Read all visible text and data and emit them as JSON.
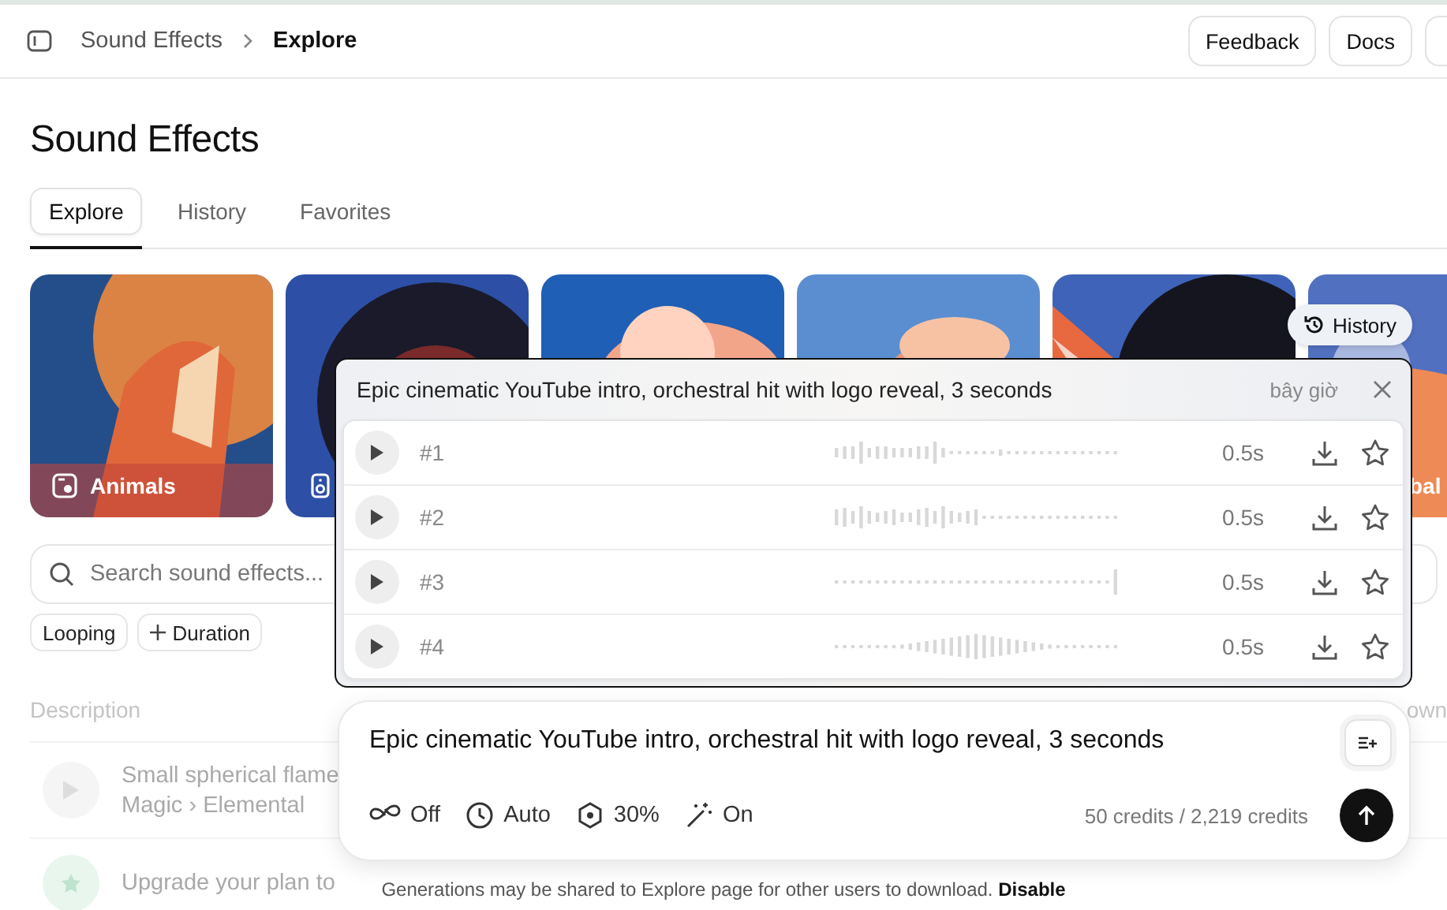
{
  "breadcrumb": {
    "parent": "Sound Effects",
    "current": "Explore"
  },
  "header_buttons": [
    "Feedback",
    "Docs"
  ],
  "title": "Sound Effects",
  "tabs": [
    {
      "label": "Explore",
      "selected": true
    },
    {
      "label": "History",
      "selected": false
    },
    {
      "label": "Favorites",
      "selected": false
    }
  ],
  "categories": [
    {
      "kind": "picture",
      "label": "Animals"
    },
    {
      "kind": "picture"
    },
    {
      "kind": "picture"
    },
    {
      "kind": "picture"
    },
    {
      "kind": "picture"
    },
    {
      "kind": "picture",
      "label": "bal"
    }
  ],
  "history_button": "History",
  "search": {
    "placeholder": "Search sound effects..."
  },
  "filters": [
    {
      "kind": "toggle",
      "label": "Looping"
    },
    {
      "kind": "add",
      "label": "Duration"
    }
  ],
  "list": {
    "columns": [
      "Description",
      "own"
    ],
    "rows": [
      {
        "kind": "sound",
        "title": "Small spherical flame",
        "path": "Magic › Elemental"
      },
      {
        "kind": "upgrade",
        "title": "Upgrade your plan to"
      }
    ]
  },
  "popup": {
    "prompt": "Epic cinematic YouTube intro, orchestral hit with logo reveal, 3 seconds",
    "time": "bây giờ",
    "results": [
      {
        "label": "#1",
        "duration": "0.5s",
        "starred": false
      },
      {
        "label": "#2",
        "duration": "0.5s",
        "starred": false
      },
      {
        "label": "#3",
        "duration": "0.5s",
        "starred": false
      },
      {
        "label": "#4",
        "duration": "0.5s",
        "starred": false
      }
    ]
  },
  "composer": {
    "value": "Epic cinematic YouTube intro, orchestral hit with logo reveal, 3 seconds",
    "options": [
      {
        "kind": "loop",
        "label": "Off"
      },
      {
        "kind": "duration",
        "label": "Auto"
      },
      {
        "kind": "influence",
        "label": "30%"
      },
      {
        "kind": "enhance",
        "label": "On"
      }
    ],
    "credits": "50 credits / 2,219 credits"
  },
  "disclaimer": {
    "text": "Generations may be shared to Explore page for other users to download.",
    "link": "Disable"
  }
}
